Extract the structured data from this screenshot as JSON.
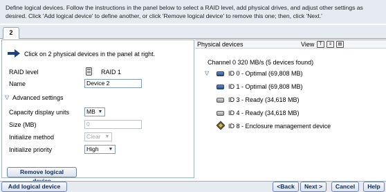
{
  "instructions": {
    "line1": "Define logical devices.  Follow the instructions in the panel below to select a RAID level, add physical drives, and adjust other settings as",
    "line2": "desired.  Click 'Add logical device' to define another, or click 'Remove logical device' to remove this one; then, click 'Next.'"
  },
  "tabs": [
    {
      "label": "2"
    }
  ],
  "left": {
    "hint": "Click on 2 physical devices in the panel at right.",
    "raid_label": "RAID level",
    "raid_value": "RAID 1",
    "name_label": "Name",
    "name_value": "Device 2",
    "advanced_label": "Advanced settings",
    "capacity_label": "Capacity display units",
    "capacity_value": "MB",
    "size_label": "Size (MB)",
    "size_value": "0",
    "init_method_label": "Initialize method",
    "init_method_value": "Clear",
    "init_priority_label": "Initialize priority",
    "init_priority_value": "High",
    "remove_button": "Remove logical device"
  },
  "right": {
    "title": "Physical devices",
    "view_label": "View",
    "channel": "Channel 0  320 MB/s (5 devices found)",
    "devices": [
      {
        "label": "ID 0 - Optimal (69,808 MB)",
        "state": "optimal",
        "expanded": true
      },
      {
        "label": "ID 1 - Optimal (69,808 MB)",
        "state": "optimal"
      },
      {
        "label": "ID 3 - Ready (34,618 MB)",
        "state": "ready"
      },
      {
        "label": "ID 4 - Ready (34,618 MB)",
        "state": "ready"
      },
      {
        "label": "ID 8 - Enclosure management device",
        "state": "enclosure"
      }
    ]
  },
  "footer": {
    "add_button": "Add logical device",
    "back_button": "<Back",
    "next_button": "Next >",
    "cancel_button": "Cancel",
    "help_button": "Help"
  },
  "colors": {
    "accent": "#102a55",
    "panel_bg": "#e6ebf2",
    "arrow": "#1c3f8c"
  }
}
